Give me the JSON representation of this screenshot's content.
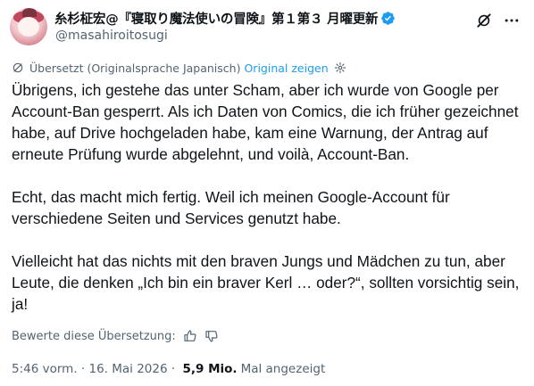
{
  "author": {
    "display_name": "糸杉柾宏@『寝取り魔法使いの冒険』第１第３ 月曜更新",
    "handle": "@masahiroitosugi",
    "verified": true
  },
  "translation": {
    "label": "Übersetzt (Originalsprache Japanisch)",
    "show_original": "Original zeigen"
  },
  "tweet": {
    "paragraphs": [
      "Übrigens, ich gestehe das unter Scham, aber ich wurde von Google per Account-Ban gesperrt. Als ich Daten von Comics, die ich früher gezeichnet habe, auf Drive hochgeladen habe, kam eine Warnung, der Antrag auf erneute Prüfung wurde abgelehnt, und voilà, Account-Ban.",
      "Echt, das macht mich fertig. Weil ich meinen Google-Account für verschiedene Seiten und Services genutzt habe.",
      "Vielleicht hat das nichts mit den braven Jungs und Mädchen zu tun, aber Leute, die denken „Ich bin ein braver Kerl … oder?“, sollten vorsichtig sein, ja!"
    ]
  },
  "rating": {
    "label": "Bewerte diese Übersetzung:"
  },
  "meta": {
    "time": "5:46 vorm.",
    "separator": " · ",
    "date": "16. Mai 2026",
    "separator2": " · ",
    "views_count": "5,9 Mio.",
    "views_label": "Mal angezeigt"
  },
  "colors": {
    "accent": "#1d9bf0",
    "text": "#0f1419",
    "secondary": "#536471"
  },
  "icons": [
    "grok-icon",
    "more-icon",
    "translate-icon",
    "gear-icon",
    "thumbs-up-icon",
    "thumbs-down-icon",
    "verified-badge-icon"
  ]
}
